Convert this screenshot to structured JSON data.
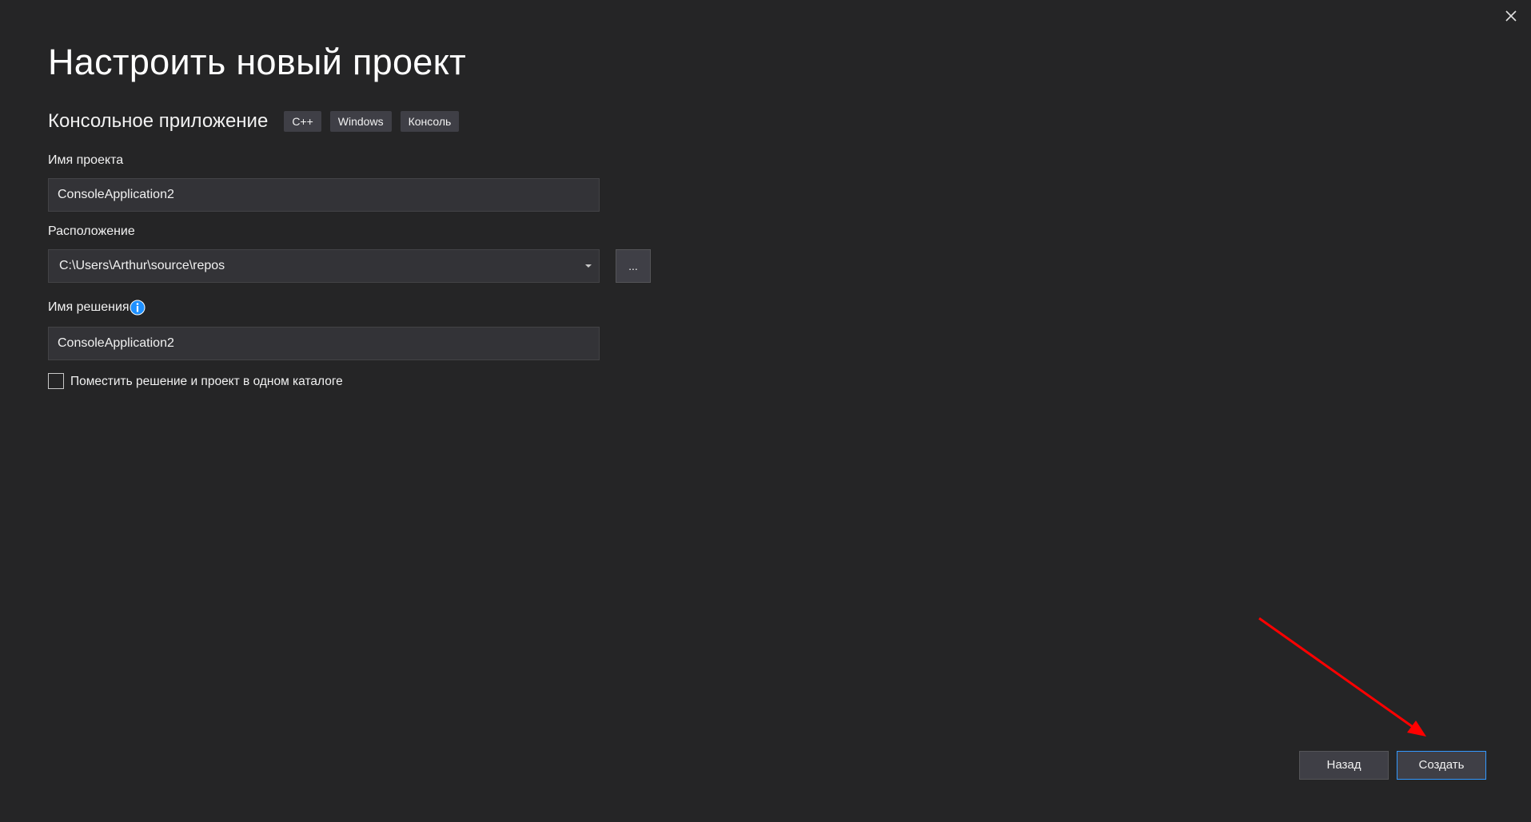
{
  "dialog": {
    "title": "Настроить новый проект",
    "template": {
      "name": "Консольное приложение",
      "tags": [
        "C++",
        "Windows",
        "Консоль"
      ]
    },
    "project_name": {
      "label": "Имя проекта",
      "value": "ConsoleApplication2"
    },
    "location": {
      "label": "Расположение",
      "value": "C:\\Users\\Arthur\\source\\repos",
      "browse_label": "..."
    },
    "solution_name": {
      "label": "Имя решения",
      "value": "ConsoleApplication2",
      "info_icon": "info-icon"
    },
    "same_directory": {
      "label": "Поместить решение и проект в одном каталоге",
      "checked": false
    },
    "buttons": {
      "back": "Назад",
      "create": "Создать"
    },
    "close_icon": "close-icon"
  },
  "annotation": {
    "arrow_color": "#ff0000"
  },
  "colors": {
    "background": "#252526",
    "field_background": "#333337",
    "tag_background": "#3f3f46",
    "accent": "#3399ff",
    "info_icon": "#1e90ff"
  }
}
